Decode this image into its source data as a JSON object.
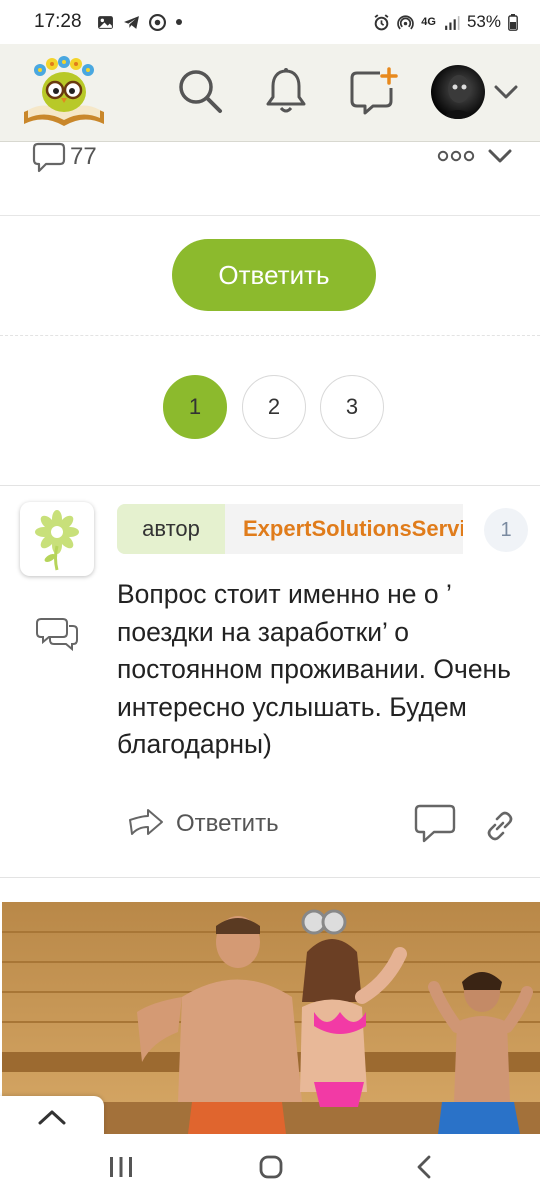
{
  "status_bar": {
    "time": "17:28",
    "left_icons": [
      "gallery-icon",
      "telegram-icon",
      "chrome-icon",
      "dot-icon"
    ],
    "right_icons": [
      "alarm-icon",
      "hotspot-icon",
      "4g-data-icon",
      "signal-icon",
      "battery-icon"
    ],
    "network": "4G",
    "battery": "53%"
  },
  "top_bar": {
    "logo_icon": "owl-book-logo-icon",
    "search_icon": "search-icon",
    "notifications_icon": "bell-icon",
    "new_post_icon": "add-message-icon",
    "profile_icon": "avatar",
    "menu_icon": "chevron-down-icon"
  },
  "post_meta": {
    "comments_count": "77",
    "more_icon": "more-dots-icon",
    "collapse_icon": "chevron-down-icon"
  },
  "reply_button": {
    "label": "Ответить"
  },
  "pagination": {
    "pages": [
      "1",
      "2",
      "3"
    ],
    "current": "1"
  },
  "comment": {
    "role": "автор",
    "author": "ExpertSolutionsService",
    "number": "1",
    "text": "Вопрос стоит именно не о ’ поездки на заработки’ о постоянном проживании. Очень интересно услышать. Будем благодарны)",
    "reply_label": "Ответить"
  },
  "colors": {
    "accent_green": "#8cba2d",
    "author_orange": "#e07c1b",
    "role_bg": "#e5f1cf"
  },
  "nav_bar": {
    "recent_icon": "recent-apps-icon",
    "home_icon": "home-icon",
    "back_icon": "back-icon"
  }
}
